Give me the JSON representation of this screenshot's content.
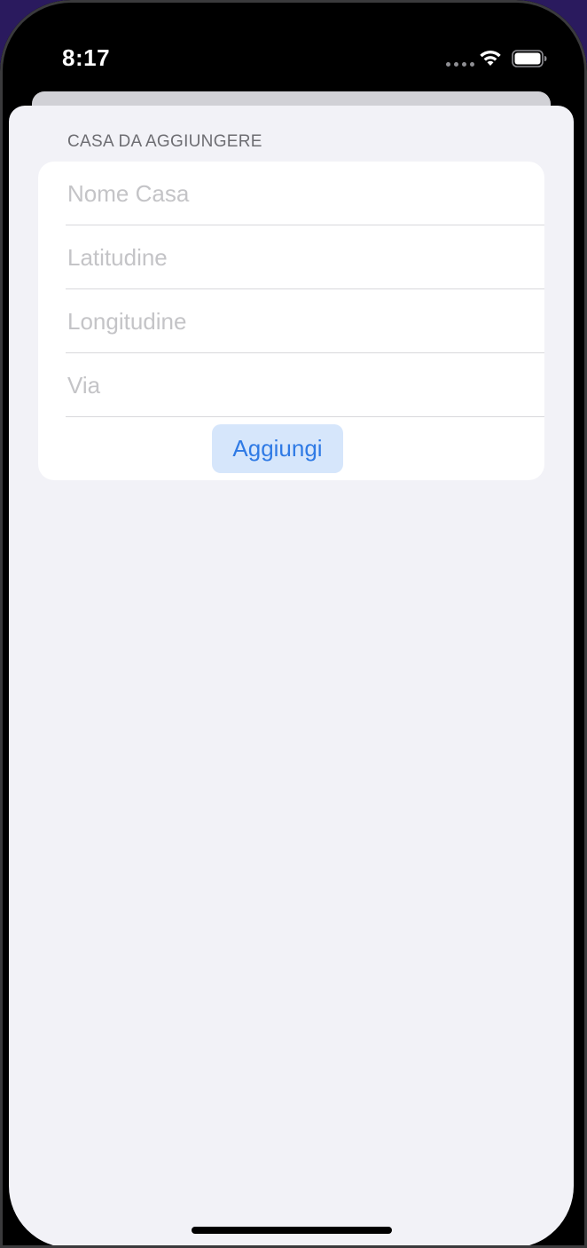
{
  "status_bar": {
    "time": "8:17",
    "signal_icon": "cellular-dots-icon",
    "wifi_icon": "wifi-icon",
    "battery_icon": "battery-icon"
  },
  "form": {
    "section_header": "CASA DA AGGIUNGERE",
    "fields": [
      {
        "placeholder": "Nome Casa",
        "value": ""
      },
      {
        "placeholder": "Latitudine",
        "value": ""
      },
      {
        "placeholder": "Longitudine",
        "value": ""
      },
      {
        "placeholder": "Via",
        "value": ""
      }
    ],
    "add_button_label": "Aggiungi"
  },
  "colors": {
    "accent": "#2f7ae5",
    "button_background": "#d6e6fb",
    "sheet_background": "#f2f2f7"
  }
}
